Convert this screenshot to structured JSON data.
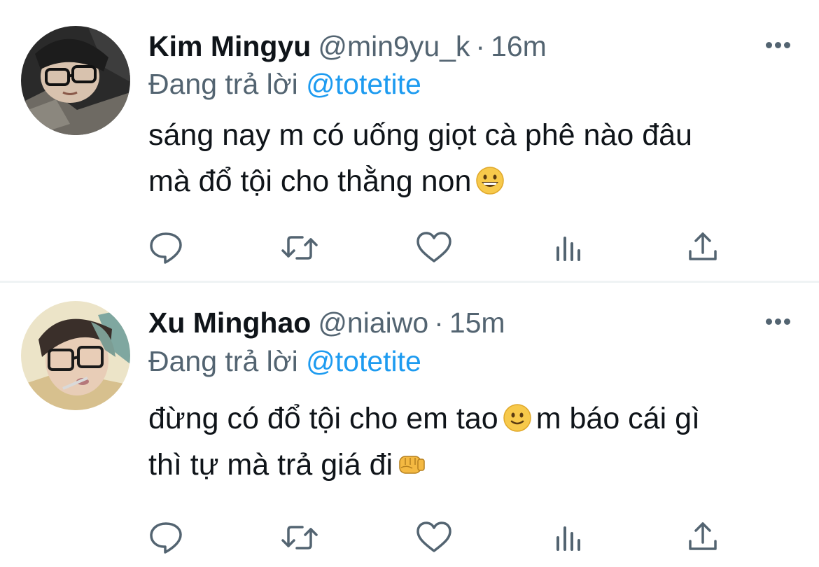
{
  "colors": {
    "secondary_text": "#536471",
    "link_blue": "#1d9bf0",
    "primary_text": "#0f1419",
    "divider": "#eff3f4"
  },
  "reply_prefix": "Đang trả lời",
  "tweets": [
    {
      "display_name": "Kim Mingyu",
      "handle": "@min9yu_k",
      "separator": "·",
      "time": "16m",
      "reply_to": "@totetite",
      "text_line_1": "sáng nay m có uống giọt cà phê nào đâu",
      "text_line_2": "mà đổ tội cho thằng non",
      "emojis": [
        "grinning-face-emoji"
      ]
    },
    {
      "display_name": "Xu Minghao",
      "handle": "@niaiwo",
      "separator": "·",
      "time": "15m",
      "reply_to": "@totetite",
      "text_line_1_a": "đừng có đổ tội cho em tao",
      "text_line_1_b": "m báo cái gì",
      "text_line_2": "thì tự mà trả giá đi",
      "emojis": [
        "slightly-smiling-face-emoji",
        "oncoming-fist-emoji"
      ]
    }
  ],
  "action_icons": [
    "reply-icon",
    "retweet-icon",
    "like-icon",
    "views-icon",
    "share-icon"
  ]
}
